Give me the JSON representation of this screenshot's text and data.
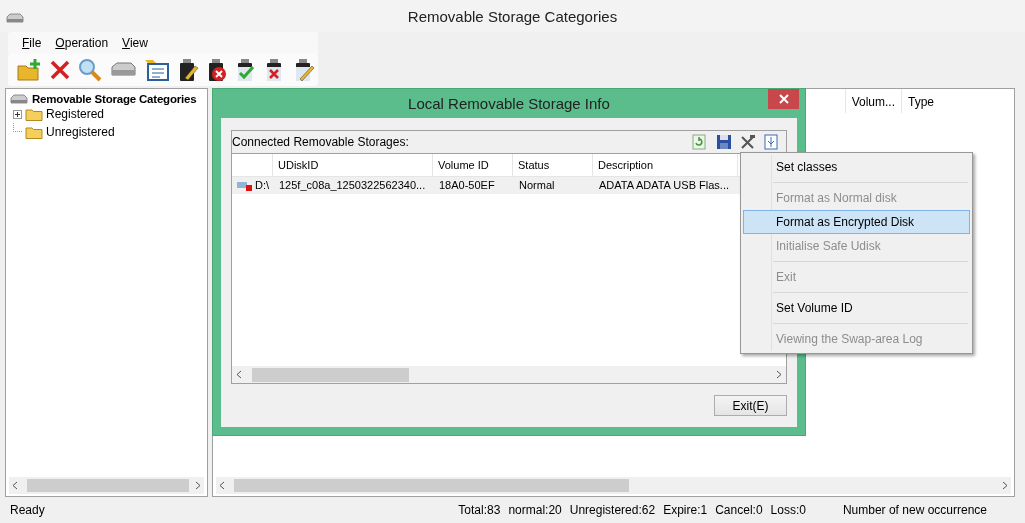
{
  "window": {
    "title": "Removable Storage Categories"
  },
  "menu_bar": [
    "File",
    "Operation",
    "View"
  ],
  "tree": {
    "root": "Removable Storage Categories",
    "items": [
      {
        "kind": "group",
        "label": "Registered",
        "expanded": false
      },
      {
        "kind": "leaf",
        "label": "Unregistered"
      }
    ]
  },
  "main_table": {
    "columns": [
      "Volum...",
      "Type"
    ]
  },
  "dialog": {
    "title": "Local Removable Storage Info",
    "group_title": "Connected Removable Storages:",
    "columns": [
      "UDiskID",
      "Volume ID",
      "Status",
      "Description"
    ],
    "rows": [
      {
        "drive": "D:\\",
        "udisk_id": "125f_c08a_1250322562340...",
        "volume_id": "18A0-50EF",
        "status": "Normal",
        "description": "ADATA ADATA USB Flas...",
        "selected": true
      }
    ],
    "exit_button": "Exit(E)"
  },
  "context_menu": [
    {
      "kind": "item",
      "label": "Set classes",
      "disabled": false,
      "selected": false
    },
    {
      "kind": "separator"
    },
    {
      "kind": "item",
      "label": "Format as Normal disk",
      "disabled": true,
      "selected": false
    },
    {
      "kind": "item",
      "label": "Format as Encrypted Disk",
      "disabled": false,
      "selected": true
    },
    {
      "kind": "item",
      "label": "Initialise Safe Udisk",
      "disabled": true,
      "selected": false
    },
    {
      "kind": "separator"
    },
    {
      "kind": "item",
      "label": "Exit",
      "disabled": true,
      "selected": false
    },
    {
      "kind": "separator"
    },
    {
      "kind": "item",
      "label": "Set Volume ID",
      "disabled": false,
      "selected": false
    },
    {
      "kind": "separator"
    },
    {
      "kind": "item",
      "label": "Viewing the Swap-area Log",
      "disabled": true,
      "selected": false
    }
  ],
  "status_bar": {
    "message": "Ready",
    "counts": [
      "Total:83",
      "normal:20",
      "Unregistered:62",
      "Expire:1",
      "Cancel:0",
      "Loss:0"
    ],
    "right": "Number of new occurrence"
  }
}
